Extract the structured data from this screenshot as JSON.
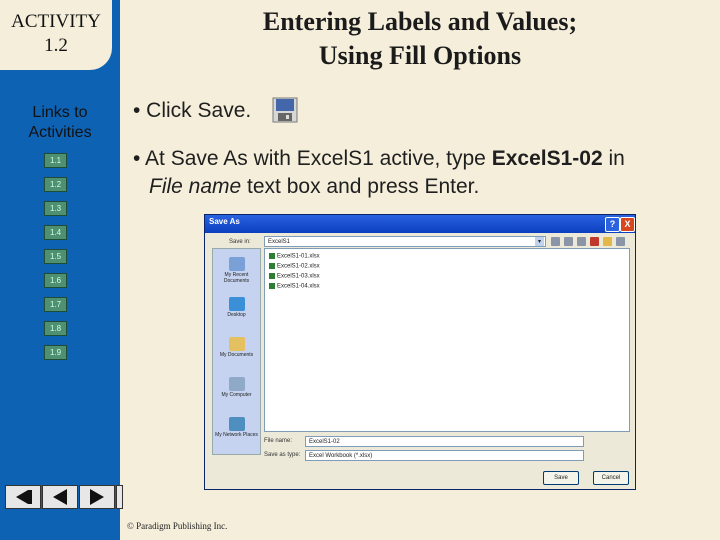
{
  "activity": {
    "label": "ACTIVITY",
    "number": "1.2"
  },
  "title_line1": "Entering Labels and Values;",
  "title_line2": "Using Fill Options",
  "links_heading": [
    "Links to",
    "Activities"
  ],
  "links": [
    "1.1",
    "1.2",
    "1.3",
    "1.4",
    "1.5",
    "1.6",
    "1.7",
    "1.8",
    "1.9"
  ],
  "bullets": {
    "b1": "• Click Save.",
    "b2_pre": "• At Save As with ExcelS1 active, type ",
    "b2_bold": "ExcelS1-02",
    "b2_post": " in",
    "b2_italic": "File name",
    "b2_end": " text box and press Enter."
  },
  "dialog": {
    "title": "Save As",
    "help": "?",
    "close": "X",
    "save_in_label": "Save in:",
    "save_in_value": "ExcelS1",
    "places": [
      "My Recent Documents",
      "Desktop",
      "My Documents",
      "My Computer",
      "My Network Places"
    ],
    "files": [
      "ExcelS1-01.xlsx",
      "ExcelS1-02.xlsx",
      "ExcelS1-03.xlsx",
      "ExcelS1-04.xlsx"
    ],
    "file_name_label": "File name:",
    "file_name_value": "ExcelS1-02",
    "save_type_label": "Save as type:",
    "save_type_value": "Excel Workbook (*.xlsx)",
    "save_button": "Save",
    "cancel_button": "Cancel"
  },
  "copyright": "© Paradigm Publishing Inc.",
  "nav_icons": [
    "first-slide-icon",
    "previous-slide-icon",
    "next-slide-icon",
    "last-slide-icon"
  ]
}
